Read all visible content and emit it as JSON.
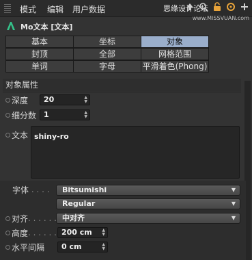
{
  "menubar": {
    "items": [
      "模式",
      "编辑",
      "用户数据"
    ],
    "watermark": "思缘设计论坛",
    "watermark_url": "www.MISSVUAN.com"
  },
  "header": {
    "title": "Mo文本 [文本]"
  },
  "tabs": [
    [
      "基本",
      "坐标",
      "对象"
    ],
    [
      "封顶",
      "全部",
      "网格范围"
    ],
    [
      "单词",
      "字母",
      "平滑着色(Phong)"
    ]
  ],
  "active_tab": "对象",
  "section": {
    "title": "对象属性"
  },
  "fields": {
    "depth": {
      "label": "深度",
      "value": "20"
    },
    "subdivision": {
      "label": "细分数",
      "value": "1"
    },
    "text": {
      "label": "文本",
      "value": "shiny-ro"
    },
    "font": {
      "label": "字体",
      "family": "Bitsumishi",
      "style": "Regular"
    },
    "align": {
      "label": "对齐",
      "value": "中对齐"
    },
    "height": {
      "label": "高度",
      "value": "200 cm"
    },
    "h_spacing": {
      "label": "水平间隔",
      "value": "0 cm"
    }
  },
  "colors": {
    "active_tab": "#9aaecb",
    "background": "#333333"
  }
}
